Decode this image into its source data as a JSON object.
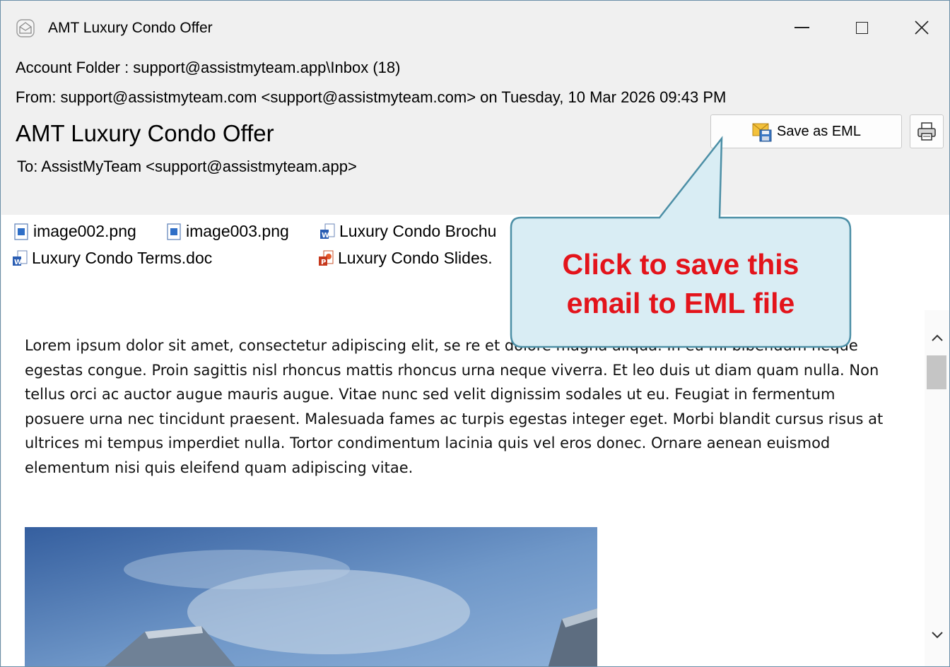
{
  "window": {
    "title": "AMT Luxury Condo Offer"
  },
  "header": {
    "account_folder": "Account Folder : support@assistmyteam.app\\Inbox (18)",
    "from": "From: support@assistmyteam.com <support@assistmyteam.com> on Tuesday, 10 Mar 2026 09:43 PM",
    "subject": "AMT Luxury Condo Offer",
    "to": "To: AssistMyTeam <support@assistmyteam.app>",
    "save_label": "Save as EML"
  },
  "attachments": [
    {
      "name": "image002.png",
      "icon": "image-file-icon"
    },
    {
      "name": "image003.png",
      "icon": "image-file-icon"
    },
    {
      "name": "Luxury Condo Brochu",
      "icon": "word-doc-icon"
    },
    {
      "name": "Luxury Condo Terms.doc",
      "icon": "word-doc-icon"
    },
    {
      "name": "Luxury Condo Slides.",
      "icon": "powerpoint-icon"
    }
  ],
  "body": {
    "paragraph": "Lorem ipsum dolor sit amet, consectetur adipiscing elit, se re et dolore magna aliqua. In eu mi bibendum neque egestas congue. Proin sagittis nisl rhoncus mattis rhoncus urna neque viverra. Et leo duis ut diam quam nulla. Non tellus orci ac auctor augue mauris augue. Vitae nunc sed velit dignissim sodales ut eu. Feugiat in fermentum posuere urna nec tincidunt praesent. Malesuada fames ac turpis egestas integer eget. Morbi blandit cursus risus at ultrices mi tempus imperdiet nulla. Tortor condimentum lacinia quis vel eros donec. Ornare aenean euismod elementum nisi quis eleifend quam adipiscing vitae."
  },
  "callout": {
    "text_line1": "Click to save this",
    "text_line2": "email to EML file",
    "text_color": "#e3141b",
    "fill_color": "#d9edf4"
  }
}
